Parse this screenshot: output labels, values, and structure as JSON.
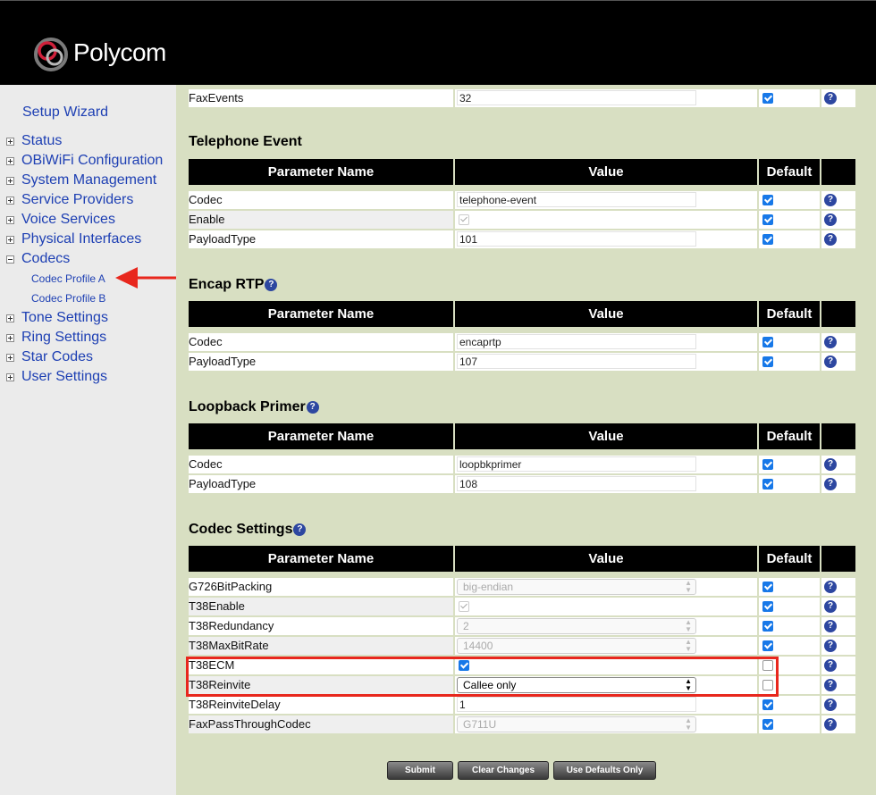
{
  "header": {
    "brand": "Polycom",
    "logo_icon": "polycom-logo-icon",
    "background": "#000000"
  },
  "sidebar": {
    "setup_wizard": "Setup Wizard",
    "items": [
      {
        "label": "Status",
        "expanded": false
      },
      {
        "label": "OBiWiFi Configuration",
        "expanded": false
      },
      {
        "label": "System Management",
        "expanded": false
      },
      {
        "label": "Service Providers",
        "expanded": false
      },
      {
        "label": "Voice Services",
        "expanded": false
      },
      {
        "label": "Physical Interfaces",
        "expanded": false
      },
      {
        "label": "Codecs",
        "expanded": true
      },
      {
        "label": "Tone Settings",
        "expanded": false
      },
      {
        "label": "Ring Settings",
        "expanded": false
      },
      {
        "label": "Star Codes",
        "expanded": false
      },
      {
        "label": "User Settings",
        "expanded": false
      }
    ],
    "codec_children": [
      "Codec Profile A",
      "Codec Profile B"
    ],
    "link_color": "#1d3fb3"
  },
  "table_headers": {
    "param": "Parameter Name",
    "value": "Value",
    "default": "Default"
  },
  "fax_events_row": {
    "name": "FaxEvents",
    "value": "32",
    "default": true
  },
  "sections": {
    "telephone_event": {
      "title": "Telephone Event",
      "rows": [
        {
          "name": "Codec",
          "value": "telephone-event",
          "default": true
        },
        {
          "name": "Enable",
          "checkbox": true,
          "default": true
        },
        {
          "name": "PayloadType",
          "value": "101",
          "default": true
        }
      ]
    },
    "encap_rtp": {
      "title": "Encap RTP",
      "rows": [
        {
          "name": "Codec",
          "value": "encaprtp",
          "default": true
        },
        {
          "name": "PayloadType",
          "value": "107",
          "default": true
        }
      ]
    },
    "loopback_primer": {
      "title": "Loopback Primer",
      "rows": [
        {
          "name": "Codec",
          "value": "loopbkprimer",
          "default": true
        },
        {
          "name": "PayloadType",
          "value": "108",
          "default": true
        }
      ]
    },
    "codec_settings": {
      "title": "Codec Settings",
      "rows": [
        {
          "name": "G726BitPacking",
          "select": "big-endian",
          "default": true
        },
        {
          "name": "T38Enable",
          "checkbox": true,
          "default": true
        },
        {
          "name": "T38Redundancy",
          "select": "2",
          "default": true
        },
        {
          "name": "T38MaxBitRate",
          "select": "14400",
          "default": true
        },
        {
          "name": "T38ECM",
          "checkbox": true,
          "default": false
        },
        {
          "name": "T38Reinvite",
          "select": "Callee only",
          "default": false
        },
        {
          "name": "T38ReinviteDelay",
          "value": "1",
          "default": true
        },
        {
          "name": "FaxPassThroughCodec",
          "select": "G711U",
          "default": true
        }
      ]
    }
  },
  "buttons": {
    "submit": "Submit",
    "clear": "Clear Changes",
    "defaults": "Use Defaults Only"
  },
  "colors": {
    "content_bg": "#d8dfc2",
    "highlight": "#e8271d",
    "checkbox": "#1778e8",
    "help_icon": "#2d47a0"
  }
}
